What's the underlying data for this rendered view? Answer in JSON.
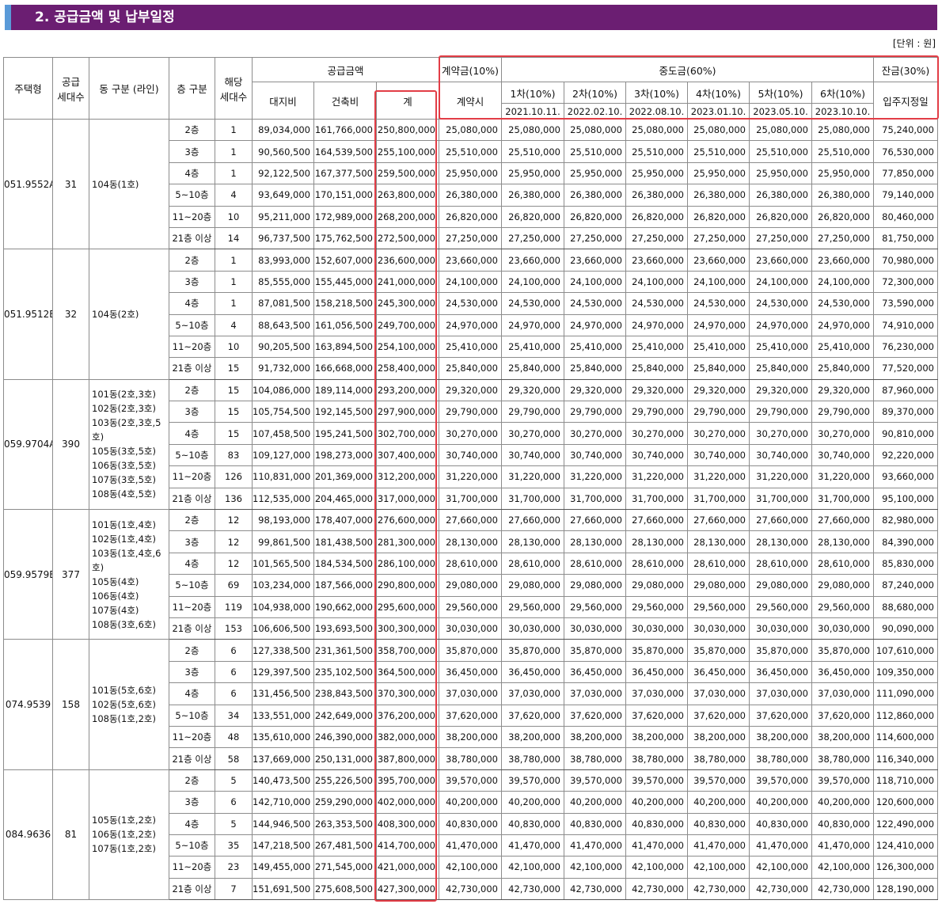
{
  "section_title": "2. 공급금액 및 납부일정",
  "unit_note": "[단위 : 원]",
  "header": {
    "housing_type": "주택형",
    "supply_units_1": "공급",
    "supply_units_2": "세대수",
    "dong": "동 구분 (라인)",
    "floor": "층 구분",
    "units_1": "해당",
    "units_2": "세대수",
    "supply_amount": "공급금액",
    "land": "대지비",
    "building": "건축비",
    "total": "계",
    "deposit": "계약금(10%)",
    "deposit_time": "계약시",
    "middle": "중도금(60%)",
    "installments": [
      {
        "label": "1차(10%)",
        "date": "2021.10.11."
      },
      {
        "label": "2차(10%)",
        "date": "2022.02.10."
      },
      {
        "label": "3차(10%)",
        "date": "2022.08.10."
      },
      {
        "label": "4차(10%)",
        "date": "2023.01.10."
      },
      {
        "label": "5차(10%)",
        "date": "2023.05.10."
      },
      {
        "label": "6차(10%)",
        "date": "2023.10.10."
      }
    ],
    "balance": "잔금(30%)",
    "balance_time": "입주지정일"
  },
  "groups": [
    {
      "type": "051.9552A",
      "supply": "31",
      "dong": [
        "104동(1호)"
      ],
      "rows": [
        {
          "floor": "2층",
          "units": "1",
          "land": "89,034,000",
          "building": "161,766,000",
          "total": "250,800,000",
          "deposit": "25,080,000",
          "middle": "25,080,000",
          "balance": "75,240,000"
        },
        {
          "floor": "3층",
          "units": "1",
          "land": "90,560,500",
          "building": "164,539,500",
          "total": "255,100,000",
          "deposit": "25,510,000",
          "middle": "25,510,000",
          "balance": "76,530,000"
        },
        {
          "floor": "4층",
          "units": "1",
          "land": "92,122,500",
          "building": "167,377,500",
          "total": "259,500,000",
          "deposit": "25,950,000",
          "middle": "25,950,000",
          "balance": "77,850,000"
        },
        {
          "floor": "5~10층",
          "units": "4",
          "land": "93,649,000",
          "building": "170,151,000",
          "total": "263,800,000",
          "deposit": "26,380,000",
          "middle": "26,380,000",
          "balance": "79,140,000"
        },
        {
          "floor": "11~20층",
          "units": "10",
          "land": "95,211,000",
          "building": "172,989,000",
          "total": "268,200,000",
          "deposit": "26,820,000",
          "middle": "26,820,000",
          "balance": "80,460,000"
        },
        {
          "floor": "21층 이상",
          "units": "14",
          "land": "96,737,500",
          "building": "175,762,500",
          "total": "272,500,000",
          "deposit": "27,250,000",
          "middle": "27,250,000",
          "balance": "81,750,000"
        }
      ]
    },
    {
      "type": "051.9512B",
      "supply": "32",
      "dong": [
        "104동(2호)"
      ],
      "rows": [
        {
          "floor": "2층",
          "units": "1",
          "land": "83,993,000",
          "building": "152,607,000",
          "total": "236,600,000",
          "deposit": "23,660,000",
          "middle": "23,660,000",
          "balance": "70,980,000"
        },
        {
          "floor": "3층",
          "units": "1",
          "land": "85,555,000",
          "building": "155,445,000",
          "total": "241,000,000",
          "deposit": "24,100,000",
          "middle": "24,100,000",
          "balance": "72,300,000"
        },
        {
          "floor": "4층",
          "units": "1",
          "land": "87,081,500",
          "building": "158,218,500",
          "total": "245,300,000",
          "deposit": "24,530,000",
          "middle": "24,530,000",
          "balance": "73,590,000"
        },
        {
          "floor": "5~10층",
          "units": "4",
          "land": "88,643,500",
          "building": "161,056,500",
          "total": "249,700,000",
          "deposit": "24,970,000",
          "middle": "24,970,000",
          "balance": "74,910,000"
        },
        {
          "floor": "11~20층",
          "units": "10",
          "land": "90,205,500",
          "building": "163,894,500",
          "total": "254,100,000",
          "deposit": "25,410,000",
          "middle": "25,410,000",
          "balance": "76,230,000"
        },
        {
          "floor": "21층 이상",
          "units": "15",
          "land": "91,732,000",
          "building": "166,668,000",
          "total": "258,400,000",
          "deposit": "25,840,000",
          "middle": "25,840,000",
          "balance": "77,520,000"
        }
      ]
    },
    {
      "type": "059.9704A",
      "supply": "390",
      "dong": [
        "101동(2호,3호)",
        "102동(2호,3호)",
        "103동(2호,3호,5호)",
        "105동(3호,5호)",
        "106동(3호,5호)",
        "107동(3호,5호)",
        "108동(4호,5호)"
      ],
      "rows": [
        {
          "floor": "2층",
          "units": "15",
          "land": "104,086,000",
          "building": "189,114,000",
          "total": "293,200,000",
          "deposit": "29,320,000",
          "middle": "29,320,000",
          "balance": "87,960,000"
        },
        {
          "floor": "3층",
          "units": "15",
          "land": "105,754,500",
          "building": "192,145,500",
          "total": "297,900,000",
          "deposit": "29,790,000",
          "middle": "29,790,000",
          "balance": "89,370,000"
        },
        {
          "floor": "4층",
          "units": "15",
          "land": "107,458,500",
          "building": "195,241,500",
          "total": "302,700,000",
          "deposit": "30,270,000",
          "middle": "30,270,000",
          "balance": "90,810,000"
        },
        {
          "floor": "5~10층",
          "units": "83",
          "land": "109,127,000",
          "building": "198,273,000",
          "total": "307,400,000",
          "deposit": "30,740,000",
          "middle": "30,740,000",
          "balance": "92,220,000"
        },
        {
          "floor": "11~20층",
          "units": "126",
          "land": "110,831,000",
          "building": "201,369,000",
          "total": "312,200,000",
          "deposit": "31,220,000",
          "middle": "31,220,000",
          "balance": "93,660,000"
        },
        {
          "floor": "21층 이상",
          "units": "136",
          "land": "112,535,000",
          "building": "204,465,000",
          "total": "317,000,000",
          "deposit": "31,700,000",
          "middle": "31,700,000",
          "balance": "95,100,000"
        }
      ]
    },
    {
      "type": "059.9579B",
      "supply": "377",
      "dong": [
        "101동(1호,4호)",
        "102동(1호,4호)",
        "103동(1호,4호,6호)",
        "105동(4호)",
        "106동(4호)",
        "107동(4호)",
        "108동(3호,6호)"
      ],
      "rows": [
        {
          "floor": "2층",
          "units": "12",
          "land": "98,193,000",
          "building": "178,407,000",
          "total": "276,600,000",
          "deposit": "27,660,000",
          "middle": "27,660,000",
          "balance": "82,980,000"
        },
        {
          "floor": "3층",
          "units": "12",
          "land": "99,861,500",
          "building": "181,438,500",
          "total": "281,300,000",
          "deposit": "28,130,000",
          "middle": "28,130,000",
          "balance": "84,390,000"
        },
        {
          "floor": "4층",
          "units": "12",
          "land": "101,565,500",
          "building": "184,534,500",
          "total": "286,100,000",
          "deposit": "28,610,000",
          "middle": "28,610,000",
          "balance": "85,830,000"
        },
        {
          "floor": "5~10층",
          "units": "69",
          "land": "103,234,000",
          "building": "187,566,000",
          "total": "290,800,000",
          "deposit": "29,080,000",
          "middle": "29,080,000",
          "balance": "87,240,000"
        },
        {
          "floor": "11~20층",
          "units": "119",
          "land": "104,938,000",
          "building": "190,662,000",
          "total": "295,600,000",
          "deposit": "29,560,000",
          "middle": "29,560,000",
          "balance": "88,680,000"
        },
        {
          "floor": "21층 이상",
          "units": "153",
          "land": "106,606,500",
          "building": "193,693,500",
          "total": "300,300,000",
          "deposit": "30,030,000",
          "middle": "30,030,000",
          "balance": "90,090,000"
        }
      ]
    },
    {
      "type": "074.9539",
      "supply": "158",
      "dong": [
        "101동(5호,6호)",
        "102동(5호,6호)",
        "108동(1호,2호)"
      ],
      "rows": [
        {
          "floor": "2층",
          "units": "6",
          "land": "127,338,500",
          "building": "231,361,500",
          "total": "358,700,000",
          "deposit": "35,870,000",
          "middle": "35,870,000",
          "balance": "107,610,000"
        },
        {
          "floor": "3층",
          "units": "6",
          "land": "129,397,500",
          "building": "235,102,500",
          "total": "364,500,000",
          "deposit": "36,450,000",
          "middle": "36,450,000",
          "balance": "109,350,000"
        },
        {
          "floor": "4층",
          "units": "6",
          "land": "131,456,500",
          "building": "238,843,500",
          "total": "370,300,000",
          "deposit": "37,030,000",
          "middle": "37,030,000",
          "balance": "111,090,000"
        },
        {
          "floor": "5~10층",
          "units": "34",
          "land": "133,551,000",
          "building": "242,649,000",
          "total": "376,200,000",
          "deposit": "37,620,000",
          "middle": "37,620,000",
          "balance": "112,860,000"
        },
        {
          "floor": "11~20층",
          "units": "48",
          "land": "135,610,000",
          "building": "246,390,000",
          "total": "382,000,000",
          "deposit": "38,200,000",
          "middle": "38,200,000",
          "balance": "114,600,000"
        },
        {
          "floor": "21층 이상",
          "units": "58",
          "land": "137,669,000",
          "building": "250,131,000",
          "total": "387,800,000",
          "deposit": "38,780,000",
          "middle": "38,780,000",
          "balance": "116,340,000"
        }
      ]
    },
    {
      "type": "084.9636",
      "supply": "81",
      "dong": [
        "105동(1호,2호)",
        "106동(1호,2호)",
        "107동(1호,2호)"
      ],
      "rows": [
        {
          "floor": "2층",
          "units": "5",
          "land": "140,473,500",
          "building": "255,226,500",
          "total": "395,700,000",
          "deposit": "39,570,000",
          "middle": "39,570,000",
          "balance": "118,710,000"
        },
        {
          "floor": "3층",
          "units": "6",
          "land": "142,710,000",
          "building": "259,290,000",
          "total": "402,000,000",
          "deposit": "40,200,000",
          "middle": "40,200,000",
          "balance": "120,600,000"
        },
        {
          "floor": "4층",
          "units": "5",
          "land": "144,946,500",
          "building": "263,353,500",
          "total": "408,300,000",
          "deposit": "40,830,000",
          "middle": "40,830,000",
          "balance": "122,490,000"
        },
        {
          "floor": "5~10층",
          "units": "35",
          "land": "147,218,500",
          "building": "267,481,500",
          "total": "414,700,000",
          "deposit": "41,470,000",
          "middle": "41,470,000",
          "balance": "124,410,000"
        },
        {
          "floor": "11~20층",
          "units": "23",
          "land": "149,455,000",
          "building": "271,545,000",
          "total": "421,000,000",
          "deposit": "42,100,000",
          "middle": "42,100,000",
          "balance": "126,300,000"
        },
        {
          "floor": "21층 이상",
          "units": "7",
          "land": "151,691,500",
          "building": "275,608,500",
          "total": "427,300,000",
          "deposit": "42,730,000",
          "middle": "42,730,000",
          "balance": "128,190,000"
        }
      ]
    }
  ],
  "highlight_color": "#e23d46",
  "banner_color": "#6b1e72"
}
